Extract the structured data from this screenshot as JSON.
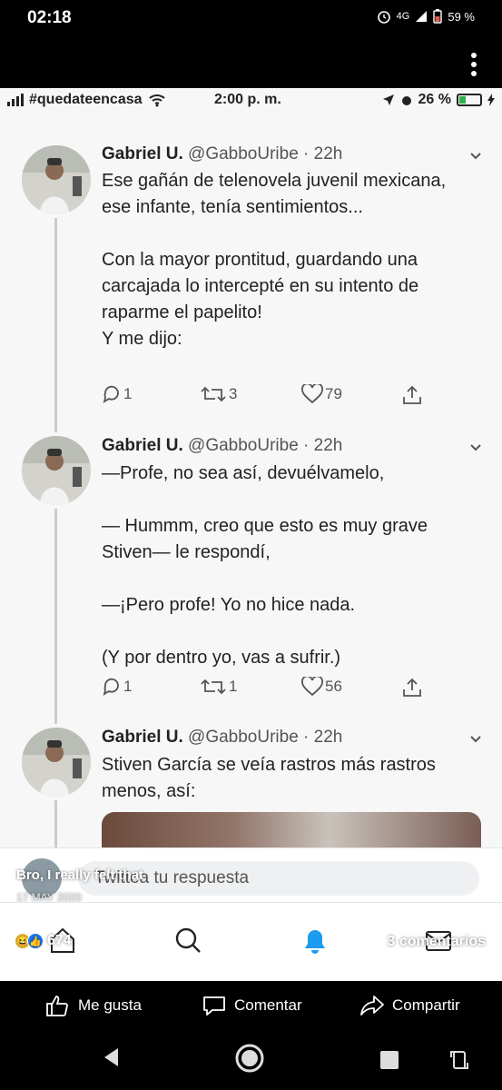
{
  "device": {
    "time": "02:18",
    "network": "4G",
    "battery": "59 %"
  },
  "inner_status": {
    "carrier": "#quedateencasa",
    "time": "2:00 p. m.",
    "battery": "26 %"
  },
  "tweets": [
    {
      "name": "Gabriel U.",
      "handle": "@GabboUribe · 22h",
      "text": "Ese gañán de telenovela juvenil mexicana, ese infante, tenía sentimientos...\n\nCon la mayor prontitud, guardando una carcajada lo intercepté en su intento de raparme el papelito!\nY me dijo:",
      "replies": "1",
      "retweets": "3",
      "likes": "79"
    },
    {
      "name": "Gabriel U.",
      "handle": "@GabboUribe · 22h",
      "text": "—Profe, no sea así, devuélvamelo,\n\n— Hummm, creo que esto es muy grave Stiven— le respondí,\n\n—¡Pero profe! Yo no hice nada.\n\n(Y por dentro yo, vas a sufrir.)",
      "replies": "1",
      "retweets": "1",
      "likes": "56"
    },
    {
      "name": "Gabriel U.",
      "handle": "@GabboUribe · 22h",
      "text": "Stiven García se veía rastros más rastros menos, así:"
    }
  ],
  "composer": {
    "placeholder": "Twittea tu respuesta"
  },
  "facebook": {
    "caption": "Bro, I really felt that",
    "date": "17 MAY 2020",
    "reactions_count": "674",
    "comments": "3 comentarios",
    "like_label": "Me gusta",
    "comment_label": "Comentar",
    "share_label": "Compartir"
  },
  "colors": {
    "background": "#f7f7f8",
    "text": "#222222",
    "accent": "#1d9bf0"
  }
}
